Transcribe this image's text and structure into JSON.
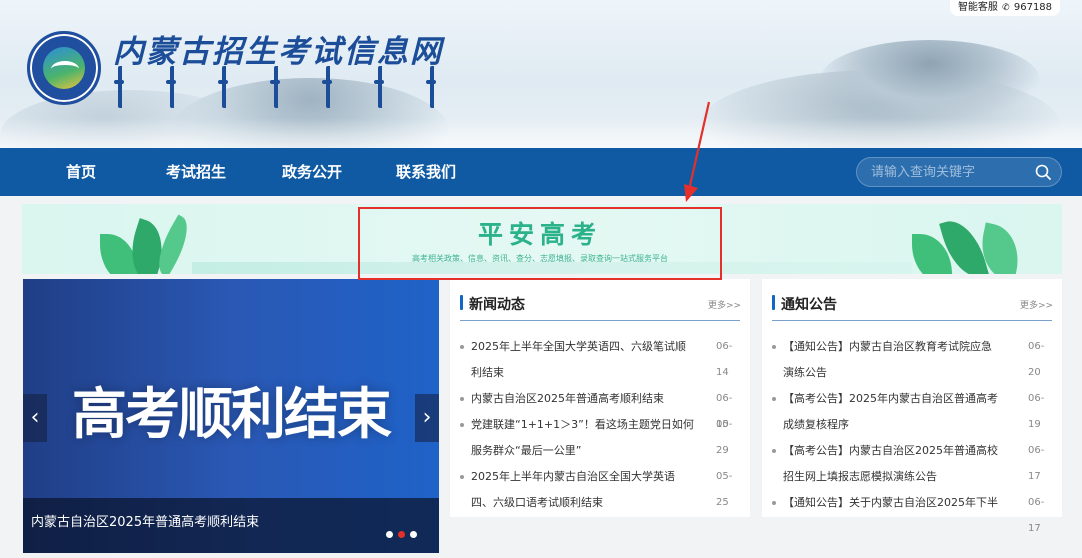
{
  "header": {
    "site_title": "内蒙古招生考试信息网",
    "service_label": "智能客服",
    "service_number": "967188"
  },
  "nav": {
    "items": [
      {
        "label": "首页"
      },
      {
        "label": "考试招生"
      },
      {
        "label": "政务公开"
      },
      {
        "label": "联系我们"
      }
    ],
    "search_placeholder": "请输入查询关键字"
  },
  "banner": {
    "title": "平安高考",
    "subtitle": "高考相关政策、信息、资讯、查分、志愿填报、录取查询一站式服务平台"
  },
  "slider": {
    "big_text": "高考顺利结束",
    "caption": "内蒙古自治区2025年普通高考顺利结束",
    "prev_glyph": "‹",
    "next_glyph": "›",
    "slide_count": 3,
    "active_slide": 2
  },
  "news": {
    "title": "新闻动态",
    "more": "更多>>",
    "items": [
      {
        "line1": "2025年上半年全国大学英语四、六级笔试顺",
        "line2": "利结束",
        "date": "06-14"
      },
      {
        "line1": "内蒙古自治区2025年普通高考顺利结束",
        "line2": "",
        "date": "06-10"
      },
      {
        "line1": "党建联建“1+1+1＞3”！看这场主题党日如何",
        "line2": "服务群众“最后一公里”",
        "date": "05-29"
      },
      {
        "line1": "2025年上半年内蒙古自治区全国大学英语",
        "line2": "四、六级口语考试顺利结束",
        "date": "05-25"
      }
    ]
  },
  "notices": {
    "title": "通知公告",
    "more": "更多>>",
    "items": [
      {
        "line1": "【通知公告】内蒙古自治区教育考试院应急",
        "line2": "演练公告",
        "date": "06-20"
      },
      {
        "line1": "【高考公告】2025年内蒙古自治区普通高考",
        "line2": "成绩复核程序",
        "date": "06-19"
      },
      {
        "line1": "【高考公告】内蒙古自治区2025年普通高校",
        "line2": "招生网上填报志愿模拟演练公告",
        "date": "06-17"
      },
      {
        "line1": "【通知公告】关于内蒙古自治区2025年下半",
        "line2": "",
        "date": "06-17"
      }
    ]
  },
  "colors": {
    "nav_bg": "#0f5aa3",
    "title_blue": "#1c4d99",
    "banner_green": "#2bb28a",
    "highlight_red": "#e3302a"
  }
}
